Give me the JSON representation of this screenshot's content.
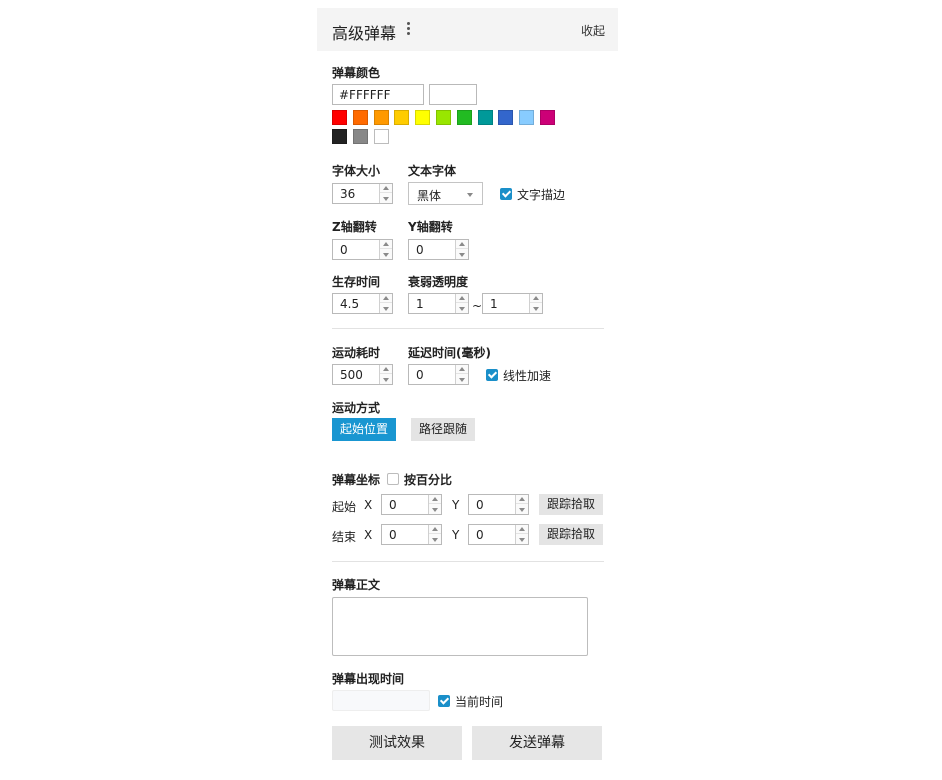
{
  "header": {
    "title": "高级弹幕",
    "menu_icon": "more-vertical-icon",
    "collapse_label": "收起"
  },
  "color": {
    "label": "弹幕颜色",
    "hex_value": "#FFFFFF",
    "preview_color": "#FFFFFF",
    "swatches": [
      "#ff0000",
      "#ff6a00",
      "#ff9900",
      "#ffcc00",
      "#ffff00",
      "#99e600",
      "#22bb22",
      "#009999",
      "#3366cc",
      "#88ccff",
      "#cc0077",
      "#222222",
      "#888888",
      "#ffffff"
    ]
  },
  "font": {
    "size_label": "字体大小",
    "size_value": "36",
    "family_label": "文本字体",
    "family_value": "黑体",
    "outline_label": "文字描边"
  },
  "flip": {
    "z_label": "Z轴翻转",
    "z_value": "0",
    "y_label": "Y轴翻转",
    "y_value": "0"
  },
  "life": {
    "time_label": "生存时间",
    "time_value": "4.5",
    "fade_label": "衰弱透明度",
    "fade_from": "1",
    "fade_sep": "~",
    "fade_to": "1"
  },
  "motion": {
    "duration_label": "运动耗时",
    "duration_value": "500",
    "delay_label": "延迟时间(毫秒)",
    "delay_value": "0",
    "linear_label": "线性加速",
    "mode_label": "运动方式",
    "mode_start": "起始位置",
    "mode_path": "路径跟随"
  },
  "coords": {
    "label": "弹幕坐标",
    "percent_label": "按百分比",
    "start_label": "起始",
    "end_label": "结束",
    "x_label": "X",
    "y_label": "Y",
    "start_x": "0",
    "start_y": "0",
    "end_x": "0",
    "end_y": "0",
    "pick_label": "跟踪拾取"
  },
  "body": {
    "label": "弹幕正文"
  },
  "appear": {
    "label": "弹幕出现时间",
    "current_label": "当前时间"
  },
  "actions": {
    "test_label": "测试效果",
    "send_label": "发送弹幕"
  }
}
